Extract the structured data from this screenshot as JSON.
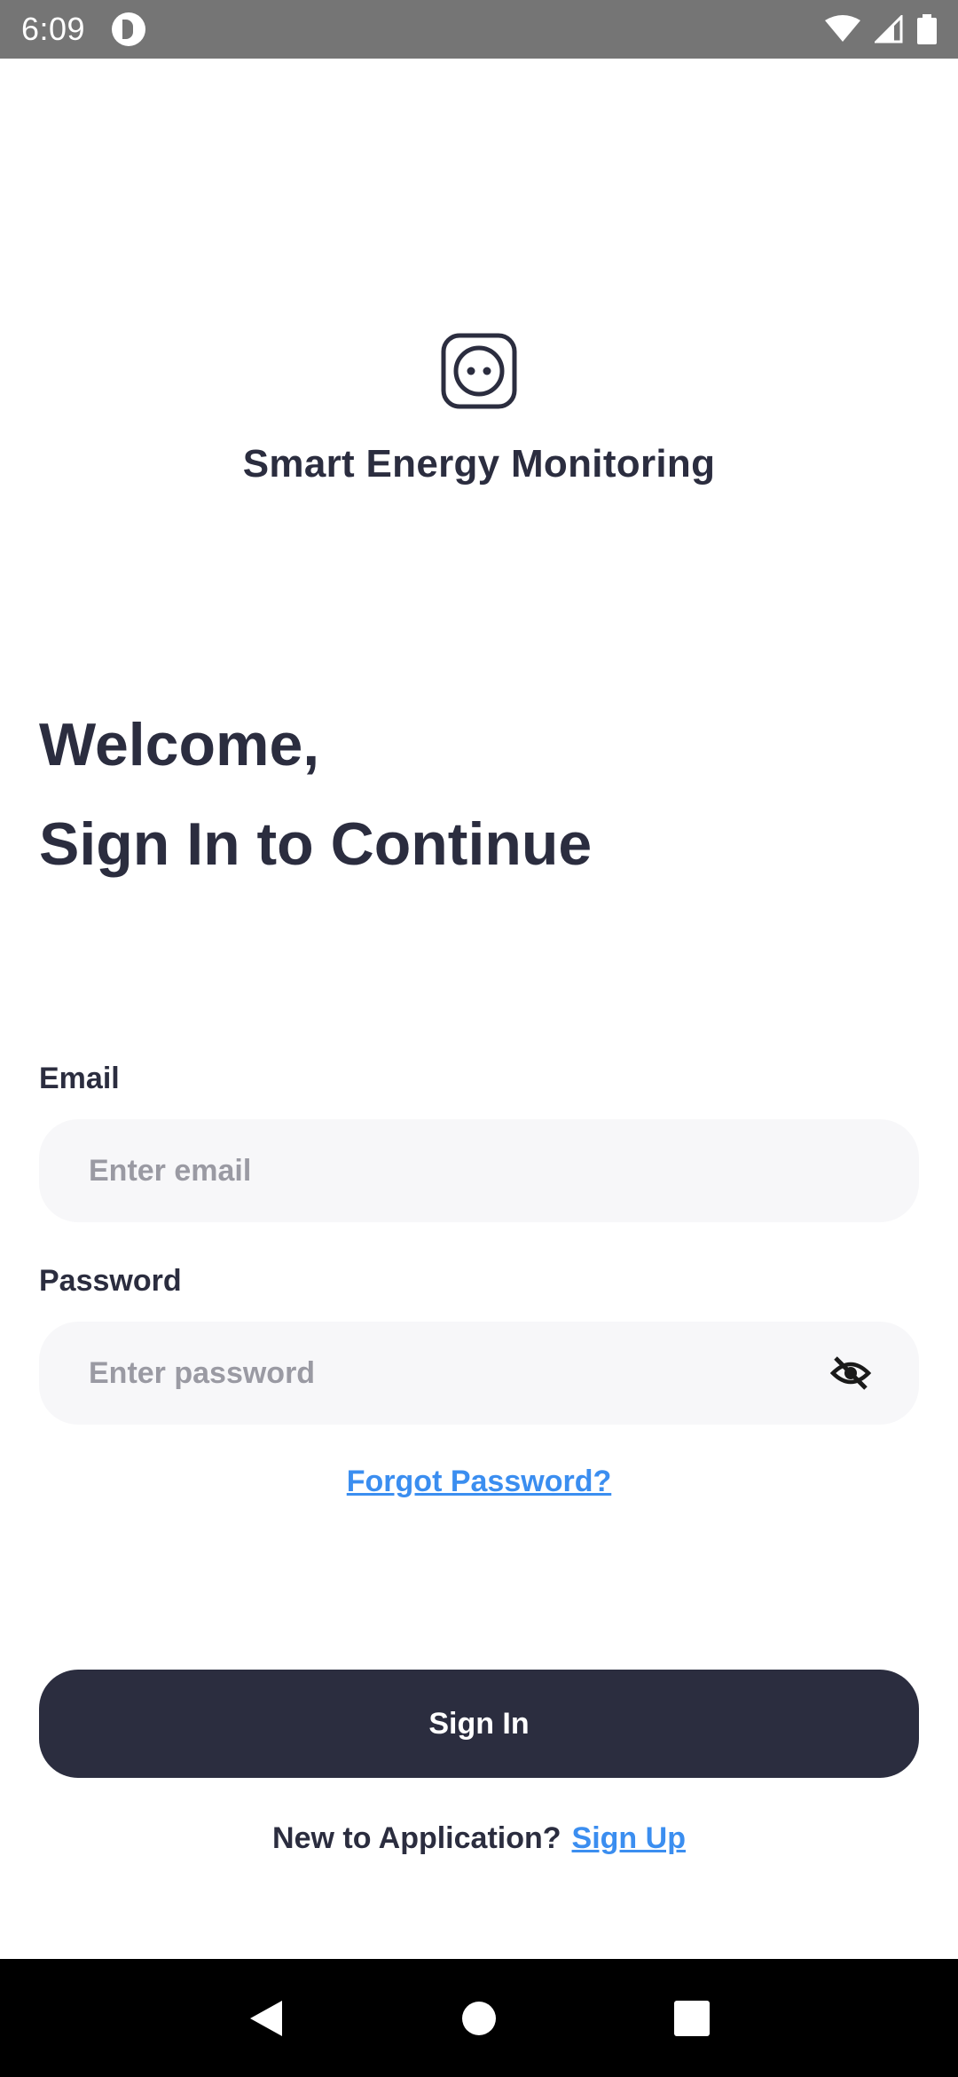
{
  "status_bar": {
    "time": "6:09",
    "icons": [
      "app-notification-icon",
      "wifi-icon",
      "cell-signal-icon",
      "battery-icon"
    ]
  },
  "app": {
    "logo_icon": "power-socket-icon",
    "name": "Smart Energy Monitoring"
  },
  "welcome": {
    "line1": "Welcome,",
    "line2": "Sign In to Continue"
  },
  "form": {
    "email_label": "Email",
    "email_value": "",
    "email_placeholder": "Enter email",
    "password_label": "Password",
    "password_value": "",
    "password_placeholder": "Enter password",
    "password_visibility_icon": "eye-off-icon",
    "forgot_password": "Forgot Password?",
    "sign_in_label": "Sign In"
  },
  "signup": {
    "prompt": "New to Application?",
    "link": "Sign Up"
  },
  "nav": {
    "icons": [
      "back-icon",
      "home-icon",
      "recents-icon"
    ]
  },
  "colors": {
    "primary_dark": "#2b2d3f",
    "link_blue": "#3b8ef0",
    "input_bg": "#f7f7f9",
    "placeholder": "#9a9aa3",
    "status_bar": "#757575"
  }
}
